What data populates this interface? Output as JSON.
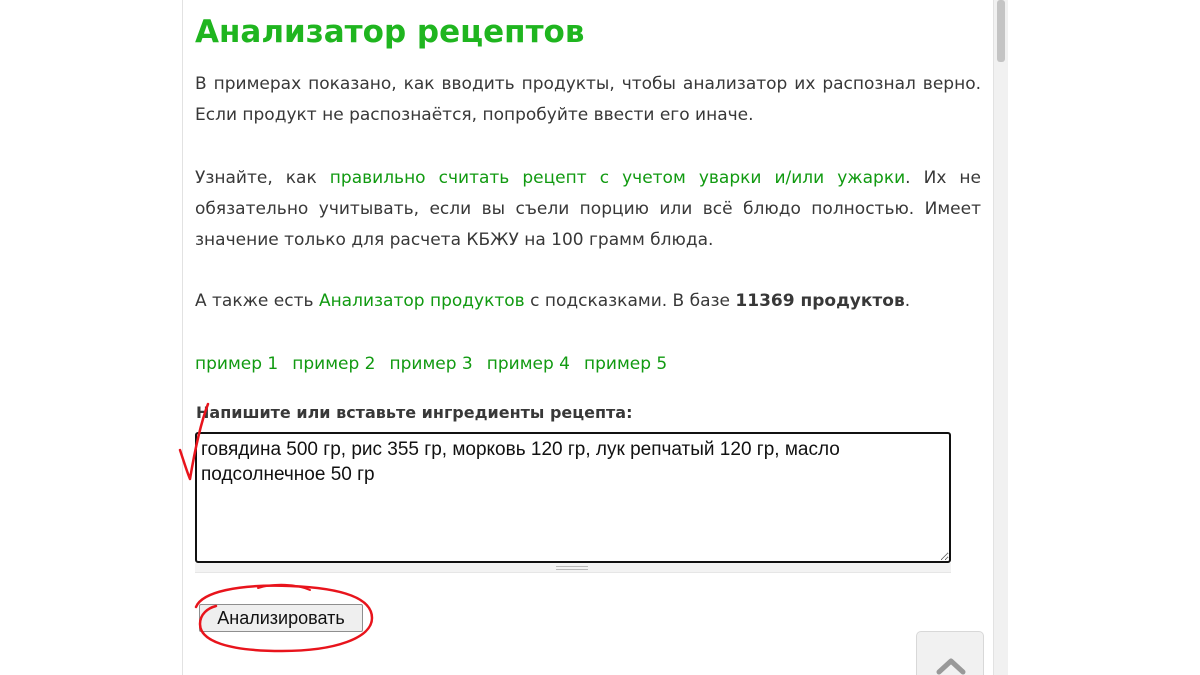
{
  "header": {
    "title": "Анализатор рецептов"
  },
  "intro": {
    "p1": "В примерах показано, как вводить продукты, чтобы анализатор их распознал верно. Если продукт не распознаётся, попробуйте ввести его иначе.",
    "p2_before": "Узнайте, как ",
    "p2_link": "правильно считать рецепт с учетом уварки и/или ужарки",
    "p2_after": ". Их не обязательно учитывать, если вы съели порцию или всё блюдо полностью. Имеет значение только для расчета КБЖУ на 100 грамм блюда.",
    "p3_before": "А также есть ",
    "p3_link": "Анализатор продуктов",
    "p3_middle": " с подсказками. В базе ",
    "p3_count": "11369 продуктов",
    "p3_after": "."
  },
  "examples": [
    {
      "label": "пример 1"
    },
    {
      "label": "пример 2"
    },
    {
      "label": "пример 3"
    },
    {
      "label": "пример 4"
    },
    {
      "label": "пример 5"
    }
  ],
  "form": {
    "label": "Напишите или вставьте ингредиенты рецепта:",
    "textarea_value": "говядина 500 гр, рис 355 гр, морковь 120 гр, лук репчатый 120 гр, масло подсолнечное 50 гр",
    "submit_label": "Анализировать"
  },
  "icons": {
    "scroll_top": "chevron-up-icon"
  },
  "colors": {
    "title": "#1fb51f",
    "link": "#119a11",
    "annotation": "#e8141c"
  }
}
